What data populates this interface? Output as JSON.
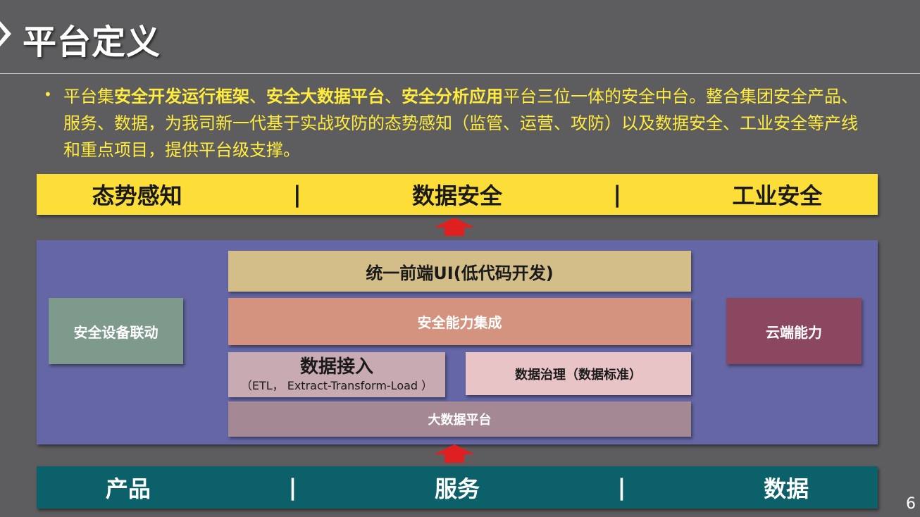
{
  "title": "平台定义",
  "intro": {
    "bullet": "•",
    "p1": "平台集",
    "e1": "安全开发运行框架",
    "s1": "、",
    "e2": "安全大数据平台",
    "s2": "、",
    "e3": "安全分析应用",
    "p2": "平台三位一体的安全中台。整合集团安全产品、服务、数据，为我司新一代基于实战攻防的态势感知（监管、运营、攻防）以及数据安全、工业安全等产线和重点项目，提供平台级支撑。"
  },
  "top_bar": {
    "items": [
      "态势感知",
      "数据安全",
      "工业安全"
    ],
    "separator": "|"
  },
  "platform": {
    "frontend_ui": "统一前端UI(低代码开发)",
    "capability_integration": "安全能力集成",
    "data_ingest": {
      "title": "数据接入",
      "subtitle": "（ETL， Extract-Transform-Load ）"
    },
    "data_governance": "数据治理（数据标准）",
    "big_data_platform": "大数据平台",
    "device_linkage": "安全设备联动",
    "cloud_capability": "云端能力"
  },
  "bottom_bar": {
    "items": [
      "产品",
      "服务",
      "数据"
    ],
    "separator": "|"
  },
  "page_number": "6",
  "colors": {
    "background": "#5d5d60",
    "top_bar": "#fdde38",
    "bottom_bar": "#0b6069",
    "platform": "#6466a5",
    "arrow": "#e02020",
    "intro_text": "#ffec3d"
  }
}
